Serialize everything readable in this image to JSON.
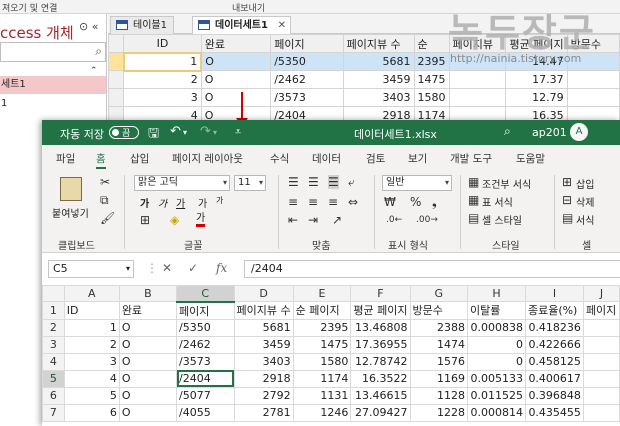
{
  "access": {
    "top_labels": [
      "져오기 및 연결",
      "내보내기"
    ],
    "nav_title": "ccess 개체",
    "nav_items": [
      "세트1",
      "1"
    ],
    "tabs": [
      {
        "label": "테이블1",
        "active": false
      },
      {
        "label": "데이터세트1",
        "active": true
      }
    ],
    "grid": {
      "headers": [
        "ID",
        "완료",
        "페이지",
        "페이지뷰 수",
        "순",
        "페이지뷰",
        "평균 페이지",
        "방문수"
      ],
      "rows": [
        [
          "1",
          "O",
          "/5350",
          "5681",
          "2395",
          "14.47"
        ],
        [
          "2",
          "O",
          "/2462",
          "3459",
          "1475",
          "17.37"
        ],
        [
          "3",
          "O",
          "/3573",
          "3403",
          "1580",
          "12.79"
        ],
        [
          "4",
          "O",
          "/2404",
          "2918",
          "1174",
          "16.35"
        ]
      ]
    }
  },
  "watermark": {
    "title": "녹두장군",
    "url": "http://nainia.tistory.com"
  },
  "excel": {
    "autosave_label": "자동 저장",
    "toggle_state": "끔",
    "file_name": "데이터세트1.xlsx",
    "user": "ap201",
    "avatar_letter": "A",
    "menu": [
      "파일",
      "홈",
      "삽입",
      "페이지 레이아웃",
      "수식",
      "데이터",
      "검토",
      "보기",
      "개발 도구",
      "도움말"
    ],
    "active_menu": "홈",
    "ribbon": {
      "paste_label": "붙여넣기",
      "clipboard_label": "클립보드",
      "font_name": "맑은 고딕",
      "font_size": "11",
      "font_group_label": "글꼴",
      "bold": "가",
      "italic": "가",
      "underline": "가",
      "grow_font": "가",
      "shrink_font": "가",
      "font_color_glyph": "가",
      "align_group_label": "맞춤",
      "number_format": "일반",
      "number_group_label": "표시 형식",
      "conditional_format": "조건부 서식",
      "table_format": "표 서식",
      "cell_styles": "셀 스타일",
      "style_group_label": "스타일",
      "insert": "삽입",
      "delete": "삭제",
      "format": "서식",
      "cells_group_label": "셀"
    },
    "name_box": "C5",
    "formula_value": "/2404",
    "columns": [
      "A",
      "B",
      "C",
      "D",
      "E",
      "F",
      "G",
      "H",
      "I",
      "J"
    ],
    "rows": [
      [
        "ID",
        "완료",
        "페이지",
        "페이지뷰 수",
        "순 페이지",
        "평균 페이지",
        "방문수",
        "이탈률",
        "종료율(%)",
        "페이지"
      ],
      [
        "1",
        "O",
        "/5350",
        "5681",
        "2395",
        "13.46808",
        "2388",
        "0.000838",
        "0.418236",
        ""
      ],
      [
        "2",
        "O",
        "/2462",
        "3459",
        "1475",
        "17.36955",
        "1474",
        "0",
        "0.422666",
        ""
      ],
      [
        "3",
        "O",
        "/3573",
        "3403",
        "1580",
        "12.78742",
        "1576",
        "0",
        "0.458125",
        ""
      ],
      [
        "4",
        "O",
        "/2404",
        "2918",
        "1174",
        "16.3522",
        "1169",
        "0.005133",
        "0.400617",
        ""
      ],
      [
        "5",
        "O",
        "/5077",
        "2792",
        "1131",
        "13.46615",
        "1128",
        "0.011525",
        "0.396848",
        ""
      ],
      [
        "6",
        "O",
        "/4055",
        "2781",
        "1246",
        "27.09427",
        "1228",
        "0.000814",
        "0.435455",
        ""
      ]
    ]
  }
}
